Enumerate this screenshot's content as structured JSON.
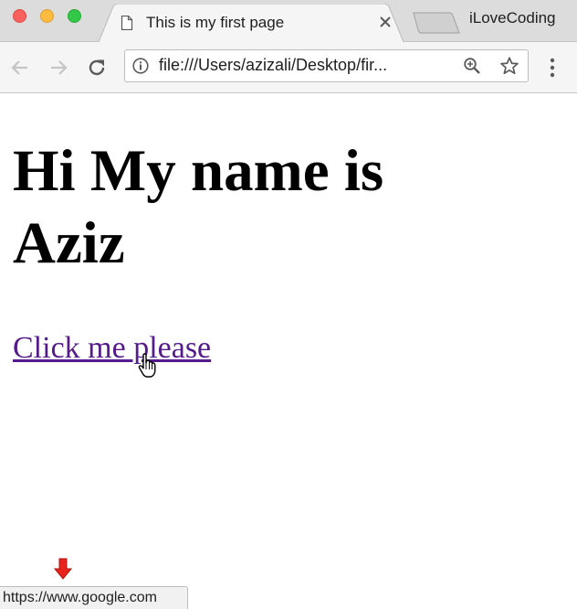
{
  "browser": {
    "tab": {
      "title": "This is my first page",
      "icon": "document-icon"
    },
    "profile_name": "iLoveCoding",
    "address_bar": {
      "url": "file:///Users/azizali/Desktop/fir..."
    }
  },
  "page": {
    "heading": "Hi My name is Aziz",
    "link_text": "Click me please"
  },
  "status_bar": {
    "url": "https://www.google.com"
  },
  "colors": {
    "link_visited": "#551a8b",
    "arrow": "#e8231b"
  }
}
